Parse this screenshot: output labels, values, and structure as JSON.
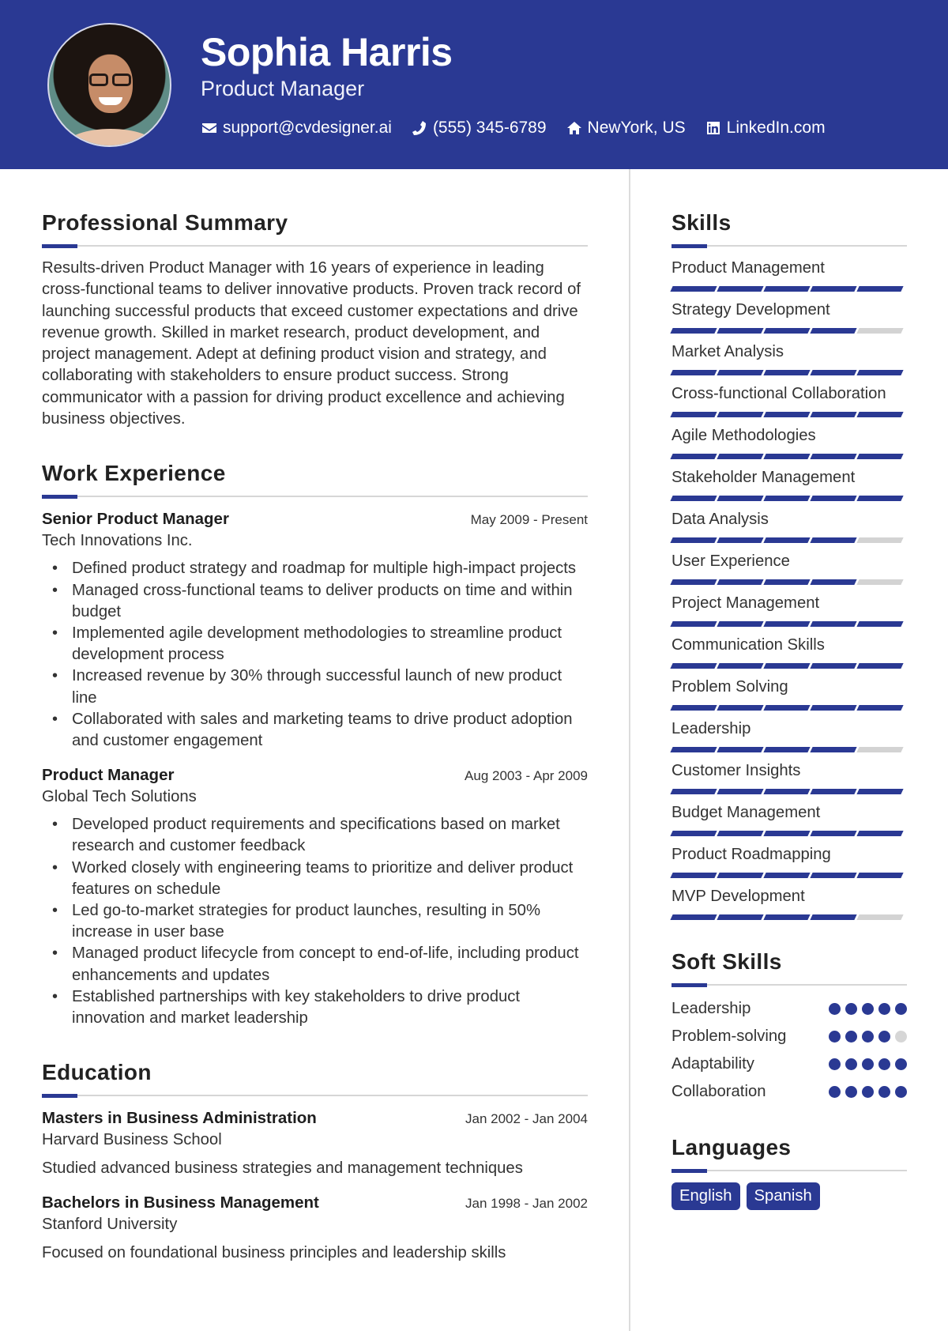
{
  "header": {
    "name": "Sophia Harris",
    "title": "Product Manager",
    "photo_alt": "Profile photo of Sophia Harris",
    "contacts": [
      {
        "icon": "envelope-icon",
        "text": "support@cvdesigner.ai"
      },
      {
        "icon": "phone-icon",
        "text": "(555) 345-6789"
      },
      {
        "icon": "home-icon",
        "text": "NewYork, US"
      },
      {
        "icon": "linkedin-icon",
        "text": "LinkedIn.com"
      }
    ]
  },
  "colors": {
    "accent": "#2A3993",
    "inactive": "#D3D3D3",
    "rule": "#D6D6D6"
  },
  "summary": {
    "title": "Professional Summary",
    "text": "Results-driven Product Manager with 16 years of experience in leading cross-functional teams to deliver innovative products. Proven track record of launching successful products that exceed customer expectations and drive revenue growth. Skilled in market research, product development, and project management. Adept at defining product vision and strategy, and collaborating with stakeholders to ensure product success. Strong communicator with a passion for driving product excellence and achieving business objectives."
  },
  "experience": {
    "title": "Work Experience",
    "jobs": [
      {
        "role": "Senior Product Manager",
        "company": "Tech Innovations Inc.",
        "dates": "May 2009 - Present",
        "bullets": [
          "Defined product strategy and roadmap for multiple high-impact projects",
          "Managed cross-functional teams to deliver products on time and within budget",
          "Implemented agile development methodologies to streamline product development process",
          "Increased revenue by 30% through successful launch of new product line",
          "Collaborated with sales and marketing teams to drive product adoption and customer engagement"
        ]
      },
      {
        "role": "Product Manager",
        "company": "Global Tech Solutions",
        "dates": "Aug 2003 - Apr 2009",
        "bullets": [
          "Developed product requirements and specifications based on market research and customer feedback",
          "Worked closely with engineering teams to prioritize and deliver product features on schedule",
          "Led go-to-market strategies for product launches, resulting in 50% increase in user base",
          "Managed product lifecycle from concept to end-of-life, including product enhancements and updates",
          "Established partnerships with key stakeholders to drive product innovation and market leadership"
        ]
      }
    ]
  },
  "education": {
    "title": "Education",
    "items": [
      {
        "degree": "Masters in Business Administration",
        "school": "Harvard Business School",
        "dates": "Jan 2002 - Jan 2004",
        "description": "Studied advanced business strategies and management techniques"
      },
      {
        "degree": "Bachelors in Business Management",
        "school": "Stanford University",
        "dates": "Jan 1998 - Jan 2002",
        "description": "Focused on foundational business principles and leadership skills"
      }
    ]
  },
  "skills": {
    "title": "Skills",
    "max_level": 5,
    "items": [
      {
        "name": "Product Management",
        "level": 5
      },
      {
        "name": "Strategy Development",
        "level": 4
      },
      {
        "name": "Market Analysis",
        "level": 5
      },
      {
        "name": "Cross-functional Collaboration",
        "level": 5
      },
      {
        "name": "Agile Methodologies",
        "level": 5
      },
      {
        "name": "Stakeholder Management",
        "level": 5
      },
      {
        "name": "Data Analysis",
        "level": 4
      },
      {
        "name": "User Experience",
        "level": 4
      },
      {
        "name": "Project Management",
        "level": 5
      },
      {
        "name": "Communication Skills",
        "level": 5
      },
      {
        "name": "Problem Solving",
        "level": 5
      },
      {
        "name": "Leadership",
        "level": 4
      },
      {
        "name": "Customer Insights",
        "level": 5
      },
      {
        "name": "Budget Management",
        "level": 5
      },
      {
        "name": "Product Roadmapping",
        "level": 5
      },
      {
        "name": "MVP Development",
        "level": 4
      }
    ]
  },
  "soft_skills": {
    "title": "Soft Skills",
    "max_level": 5,
    "items": [
      {
        "name": "Leadership",
        "level": 5
      },
      {
        "name": "Problem-solving",
        "level": 4
      },
      {
        "name": "Adaptability",
        "level": 5
      },
      {
        "name": "Collaboration",
        "level": 5
      }
    ]
  },
  "languages": {
    "title": "Languages",
    "items": [
      "English",
      "Spanish"
    ]
  }
}
